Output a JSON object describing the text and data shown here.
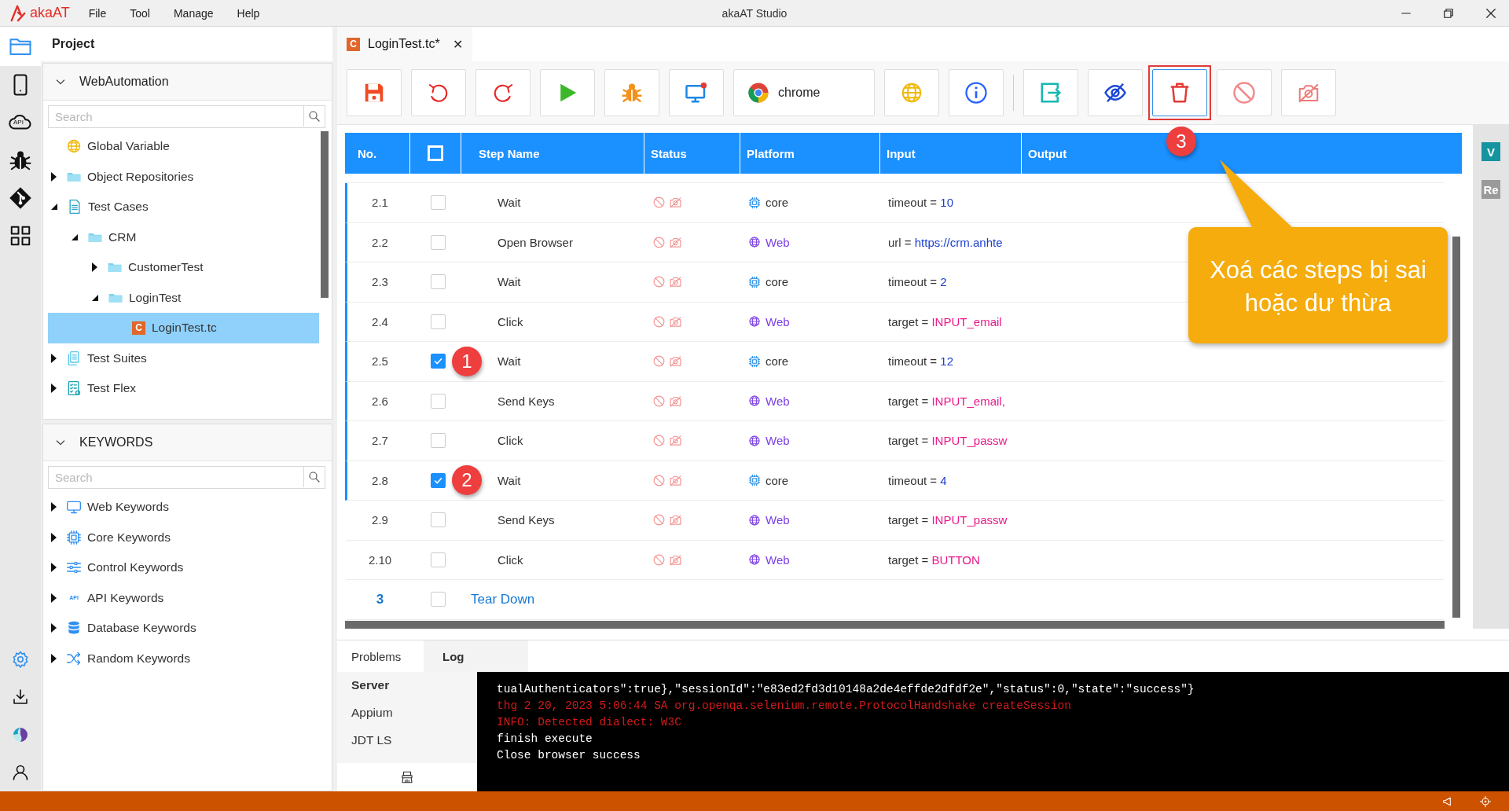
{
  "window": {
    "logo": "akaAT",
    "title": "akaAT Studio",
    "menu": [
      "File",
      "Tool",
      "Manage",
      "Help"
    ]
  },
  "rail": {
    "top": [
      {
        "selected": true
      },
      {
        "selected": false
      },
      {
        "label": "API",
        "selected": false
      },
      {
        "selected": false
      },
      {
        "selected": false
      },
      {
        "selected": false
      }
    ],
    "bottom": [
      {
        "selected": false
      },
      {
        "selected": false
      },
      {
        "selected": false
      },
      {
        "selected": false
      }
    ]
  },
  "project": {
    "title": "Project",
    "section": "WebAutomation",
    "search": {
      "placeholder": "Search"
    },
    "tree": [
      {
        "label": "Global Variable",
        "kind": "globe",
        "selected": false
      },
      {
        "label": "Object Repositories",
        "kind": "folder",
        "expandable": true,
        "expanded": false,
        "selected": false
      },
      {
        "label": "Test Cases",
        "kind": "doc",
        "expandable": true,
        "expanded": true,
        "selected": false,
        "children": [
          {
            "label": "CRM",
            "kind": "folder",
            "expandable": true,
            "expanded": true,
            "selected": false,
            "children": [
              {
                "label": "CustomerTest",
                "kind": "folder",
                "expandable": true,
                "expanded": false,
                "selected": false
              },
              {
                "label": "LoginTest",
                "kind": "folder",
                "expandable": true,
                "expanded": true,
                "selected": false,
                "children": [
                  {
                    "label": "LoginTest.tc",
                    "kind": "file",
                    "badge": "C",
                    "selected": true
                  }
                ]
              }
            ]
          }
        ]
      },
      {
        "label": "Test Suites",
        "kind": "suites",
        "expandable": true,
        "expanded": false,
        "selected": false
      },
      {
        "label": "Test Flex",
        "kind": "flex",
        "expandable": true,
        "expanded": false,
        "selected": false
      }
    ]
  },
  "keywords": {
    "section": "KEYWORDS",
    "search": {
      "placeholder": "Search"
    },
    "items": [
      {
        "label": "Web Keywords",
        "kind": "monitor"
      },
      {
        "label": "Core Keywords",
        "kind": "chip"
      },
      {
        "label": "Control Keywords",
        "kind": "sliders"
      },
      {
        "label": "API Keywords",
        "kind": "api",
        "icon_label": "API"
      },
      {
        "label": "Database Keywords",
        "kind": "database"
      },
      {
        "label": "Random Keywords",
        "kind": "shuffle"
      }
    ]
  },
  "editor_tab": {
    "badge": "C",
    "label": "LoginTest.tc*",
    "close": "✕"
  },
  "toolbar": {
    "groups": [
      [
        {
          "kind": "save"
        },
        {
          "kind": "undo"
        },
        {
          "kind": "redo"
        },
        {
          "kind": "run"
        },
        {
          "kind": "debug"
        },
        {
          "kind": "record"
        },
        {
          "kind": "browser",
          "label": "chrome"
        },
        {
          "kind": "globe"
        },
        {
          "kind": "info"
        }
      ],
      [
        {
          "kind": "export"
        },
        {
          "kind": "hide"
        },
        {
          "kind": "delete",
          "highlighted": true,
          "badge": "3"
        },
        {
          "kind": "disable"
        },
        {
          "kind": "camera-off"
        }
      ]
    ]
  },
  "table": {
    "columns": [
      "No.",
      "Step Name",
      "Status",
      "Platform",
      "Input",
      "Output"
    ],
    "select_all": {
      "checked": false
    },
    "rows": [
      {
        "no": "2.1",
        "checked": false,
        "bar": true,
        "name": "Wait",
        "platform": {
          "kind": "core",
          "label": "core"
        },
        "input": {
          "key": "timeout =",
          "value": "10",
          "kind": "number"
        }
      },
      {
        "no": "2.2",
        "checked": false,
        "bar": true,
        "name": "Open Browser",
        "platform": {
          "kind": "web",
          "label": "Web"
        },
        "input": {
          "key": "url =",
          "value": "https://crm.anhte",
          "kind": "url"
        }
      },
      {
        "no": "2.3",
        "checked": false,
        "bar": true,
        "name": "Wait",
        "platform": {
          "kind": "core",
          "label": "core"
        },
        "input": {
          "key": "timeout =",
          "value": "2",
          "kind": "number"
        }
      },
      {
        "no": "2.4",
        "checked": false,
        "bar": true,
        "name": "Click",
        "platform": {
          "kind": "web",
          "label": "Web"
        },
        "input": {
          "key": "target =",
          "value": "INPUT_email",
          "kind": "target"
        }
      },
      {
        "no": "2.5",
        "checked": true,
        "bar": true,
        "badge": "1",
        "name": "Wait",
        "platform": {
          "kind": "core",
          "label": "core"
        },
        "input": {
          "key": "timeout =",
          "value": "12",
          "kind": "number"
        }
      },
      {
        "no": "2.6",
        "checked": false,
        "bar": true,
        "name": "Send Keys",
        "platform": {
          "kind": "web",
          "label": "Web"
        },
        "input": {
          "key": "target =",
          "value": "INPUT_email,",
          "kind": "target"
        }
      },
      {
        "no": "2.7",
        "checked": false,
        "bar": true,
        "name": "Click",
        "platform": {
          "kind": "web",
          "label": "Web"
        },
        "input": {
          "key": "target =",
          "value": "INPUT_passw",
          "kind": "target"
        }
      },
      {
        "no": "2.8",
        "checked": true,
        "bar": true,
        "badge": "2",
        "name": "Wait",
        "platform": {
          "kind": "core",
          "label": "core"
        },
        "input": {
          "key": "timeout =",
          "value": "4",
          "kind": "number"
        }
      },
      {
        "no": "2.9",
        "checked": false,
        "bar": false,
        "name": "Send Keys",
        "platform": {
          "kind": "web",
          "label": "Web"
        },
        "input": {
          "key": "target =",
          "value": "INPUT_passw",
          "kind": "target"
        }
      },
      {
        "no": "2.10",
        "checked": false,
        "bar": false,
        "name": "Click",
        "platform": {
          "kind": "web",
          "label": "Web"
        },
        "input": {
          "key": "target =",
          "value": "BUTTON",
          "kind": "target"
        }
      },
      {
        "no": "3",
        "checked": false,
        "bar": false,
        "kind": "group",
        "name": "Tear Down"
      }
    ]
  },
  "callout": {
    "text": "Xoá các steps bị sai hoặc dư thừa"
  },
  "side_badges": [
    {
      "label": "V",
      "kind": "teal"
    },
    {
      "label": "Re",
      "kind": "gray"
    }
  ],
  "bottom": {
    "tabs": [
      {
        "label": "Problems",
        "selected": false
      },
      {
        "label": "Log",
        "selected": true
      }
    ],
    "servers": [
      {
        "label": "Server",
        "selected": true
      },
      {
        "label": "Appium",
        "selected": false
      },
      {
        "label": "JDT LS",
        "selected": false
      }
    ],
    "log": [
      {
        "text": "tualAuthenticators\":true},\"sessionId\":\"e83ed2fd3d10148a2de4effde2dfdf2e\",\"status\":0,\"state\":\"success\"}",
        "kind": "plain"
      },
      {
        "text": "thg 2 20, 2023 5:06:44 SA org.openqa.selenium.remote.ProtocolHandshake createSession",
        "kind": "error"
      },
      {
        "text": "INFO: Detected dialect: W3C",
        "kind": "error"
      },
      {
        "text": "finish execute",
        "kind": "plain"
      },
      {
        "text": "Close browser success",
        "kind": "plain"
      }
    ]
  }
}
